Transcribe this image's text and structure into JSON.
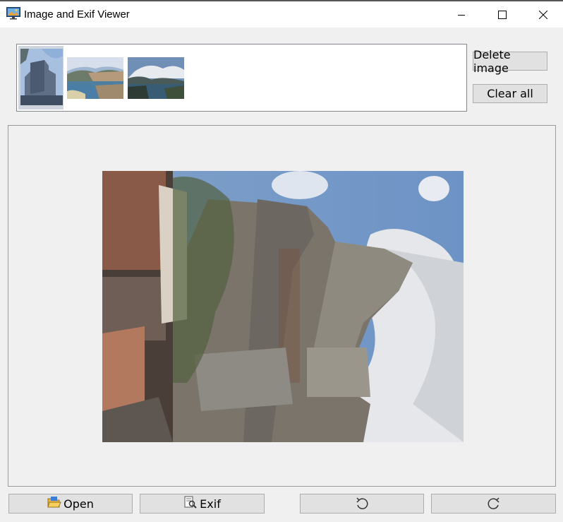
{
  "window": {
    "title": "Image and Exif Viewer",
    "icon": "monitor-picture-icon",
    "controls": [
      "minimize-icon",
      "maximize-icon",
      "close-icon"
    ]
  },
  "thumbnails": [
    {
      "name": "castle-tower",
      "selected": true
    },
    {
      "name": "seaside-town",
      "selected": false
    },
    {
      "name": "coast-clouds",
      "selected": false
    }
  ],
  "side_buttons": {
    "delete_label": "Delete image",
    "clear_label": "Clear all"
  },
  "toolbar": {
    "open_label": "Open",
    "open_icon": "folder-open-icon",
    "exif_label": "Exif",
    "exif_icon": "document-search-icon",
    "rotate_left_icon": "rotate-left-icon",
    "rotate_right_icon": "rotate-right-icon"
  }
}
